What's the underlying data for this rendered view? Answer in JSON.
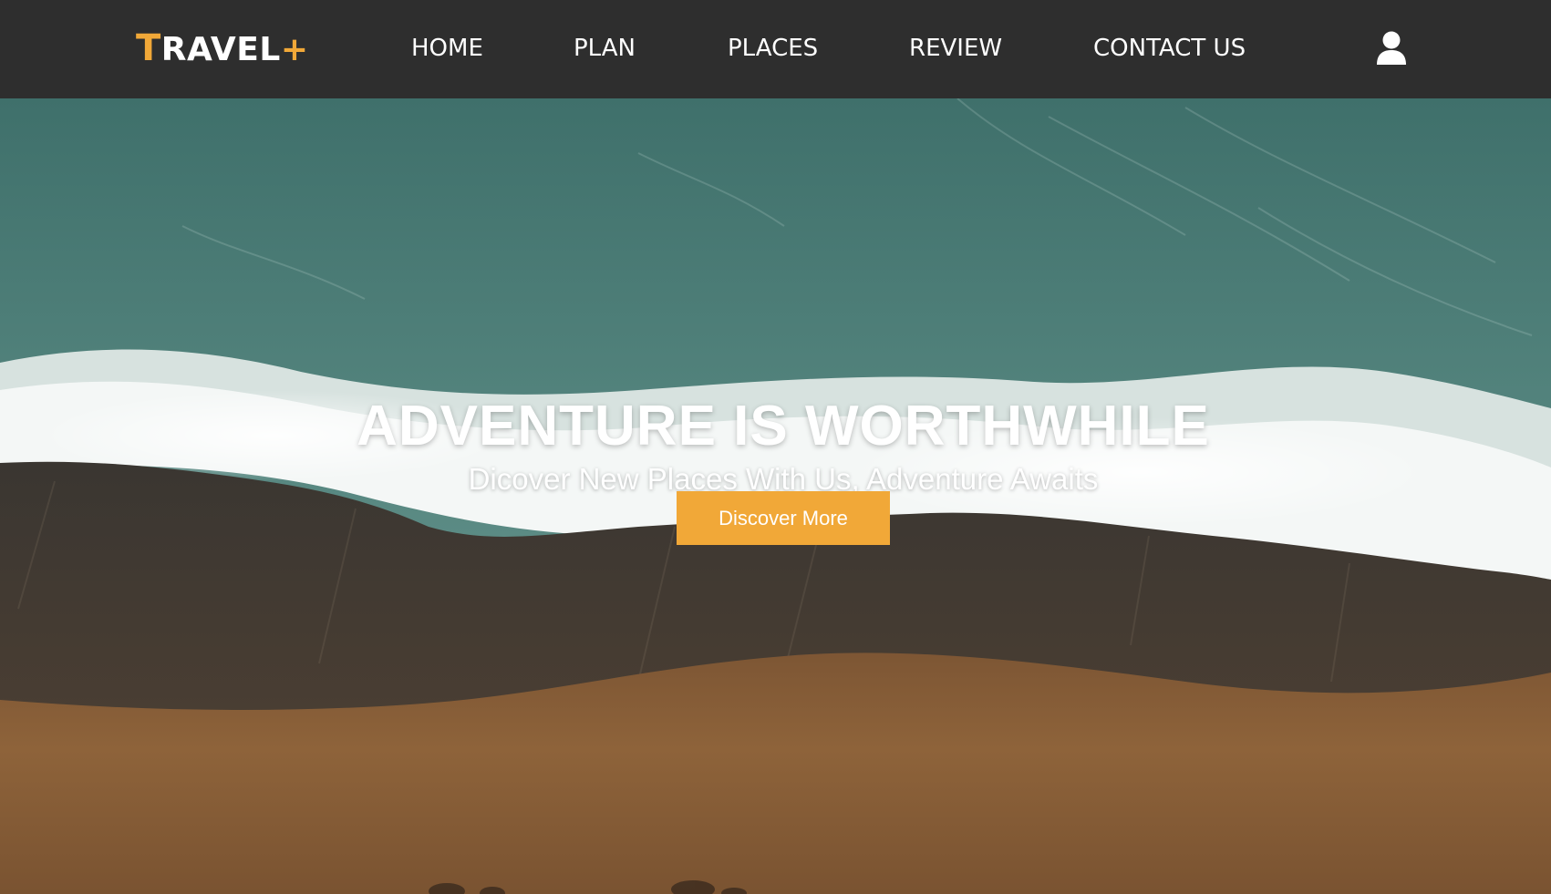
{
  "brand": {
    "logo_first_letter": "T",
    "logo_rest": "RAVEL",
    "logo_plus": "+"
  },
  "nav": {
    "items": [
      {
        "label": "HOME"
      },
      {
        "label": "PLAN"
      },
      {
        "label": "PLACES"
      },
      {
        "label": "REVIEW"
      },
      {
        "label": "CONTACT US"
      }
    ],
    "user_icon": "user-icon"
  },
  "hero": {
    "title": "ADVENTURE IS WORTHWHILE",
    "subtitle": "Dicover New Places With Us, Adventure Awaits",
    "button_label": "Discover More",
    "background": "aerial-beach-waves-image"
  },
  "colors": {
    "navbar_bg": "#2e2e2e",
    "accent": "#f1a838",
    "text": "#ffffff"
  }
}
